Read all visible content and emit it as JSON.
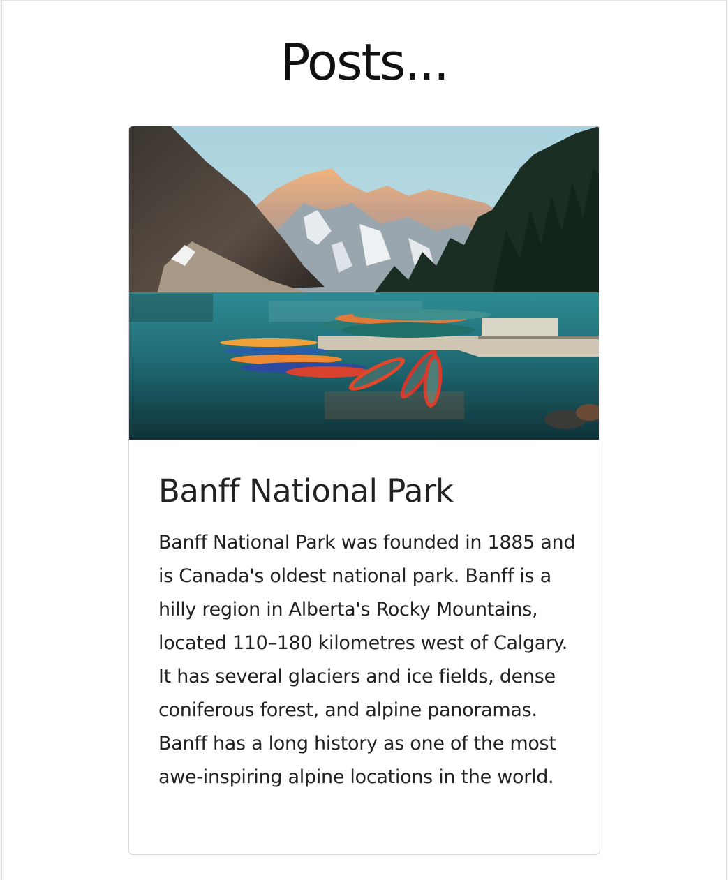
{
  "page": {
    "title": "Posts..."
  },
  "post": {
    "image_alt": "Canoes docked at Moraine Lake beneath snow-capped mountains",
    "title": "Banff National Park",
    "body": "Banff National Park was founded in 1885 and is Canada's oldest national park. Banff is a hilly region in Alberta's Rocky Mountains, located 110–180 kilometres west of Calgary. It has several glaciers and ice fields, dense coniferous forest, and alpine panoramas. Banff has a long history as one of the most awe-inspiring alpine locations in the world."
  }
}
